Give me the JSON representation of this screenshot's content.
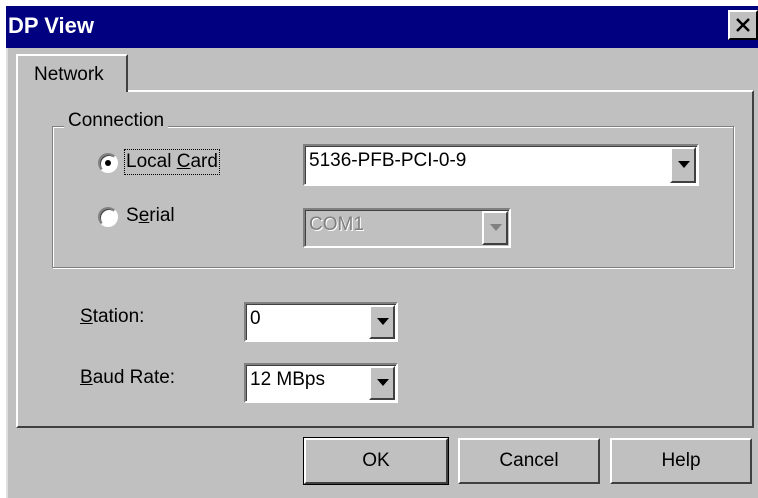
{
  "window": {
    "title": "DP View",
    "close_icon": "close-icon"
  },
  "tabs": [
    {
      "label": "Network",
      "selected": true
    }
  ],
  "connection": {
    "group_label": "Connection",
    "local_card": {
      "label_pre": "Local ",
      "label_key": "C",
      "label_post": "ard",
      "selected": true,
      "value": "5136-PFB-PCI-0-9"
    },
    "serial": {
      "label_pre": "S",
      "label_key": "e",
      "label_post": "rial",
      "selected": false,
      "value": "COM1",
      "enabled": false
    }
  },
  "station": {
    "label_key": "S",
    "label_post": "tation:",
    "value": "0"
  },
  "baud_rate": {
    "label_key": "B",
    "label_post": "aud Rate:",
    "value": "12 MBps"
  },
  "buttons": {
    "ok": "OK",
    "cancel": "Cancel",
    "help": "Help"
  }
}
